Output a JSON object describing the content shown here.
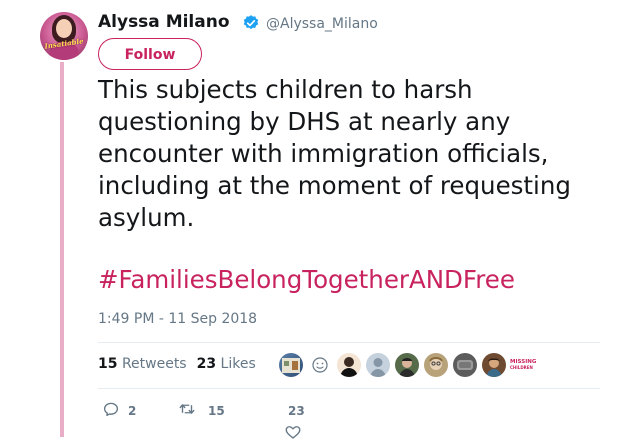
{
  "author": {
    "display_name": "Alyssa Milano",
    "handle": "@Alyssa_Milano",
    "verified": true,
    "avatar_caption": "Insatiable"
  },
  "follow_button": {
    "label": "Follow"
  },
  "tweet": {
    "text": "This subjects children to harsh questioning by DHS at nearly any encounter with immigration officials, including at the moment of requesting asylum.",
    "hashtag": "#FamiliesBelongTogetherANDFree",
    "timestamp": "1:49 PM - 11 Sep 2018"
  },
  "stats": {
    "retweets_count": "15",
    "retweets_label": "Retweets",
    "likes_count": "23",
    "likes_label": "Likes"
  },
  "likers": {
    "avatars": [
      "liker-avatar-1",
      "liker-avatar-2",
      "liker-avatar-3",
      "liker-avatar-4",
      "liker-avatar-5",
      "liker-avatar-6",
      "liker-avatar-7",
      "liker-avatar-8"
    ],
    "badge_line1": "MISSING",
    "badge_line2": "CHILDREN"
  },
  "actions": {
    "reply_count": "2",
    "retweet_count": "15",
    "like_count": "23"
  },
  "colors": {
    "accent": "#c8235f",
    "thread_line": "#e8aec8",
    "secondary_text": "#657786",
    "verified_badge": "#1da1f2"
  },
  "icons": [
    "verified-badge-icon",
    "reply-icon",
    "retweet-icon",
    "heart-icon"
  ]
}
